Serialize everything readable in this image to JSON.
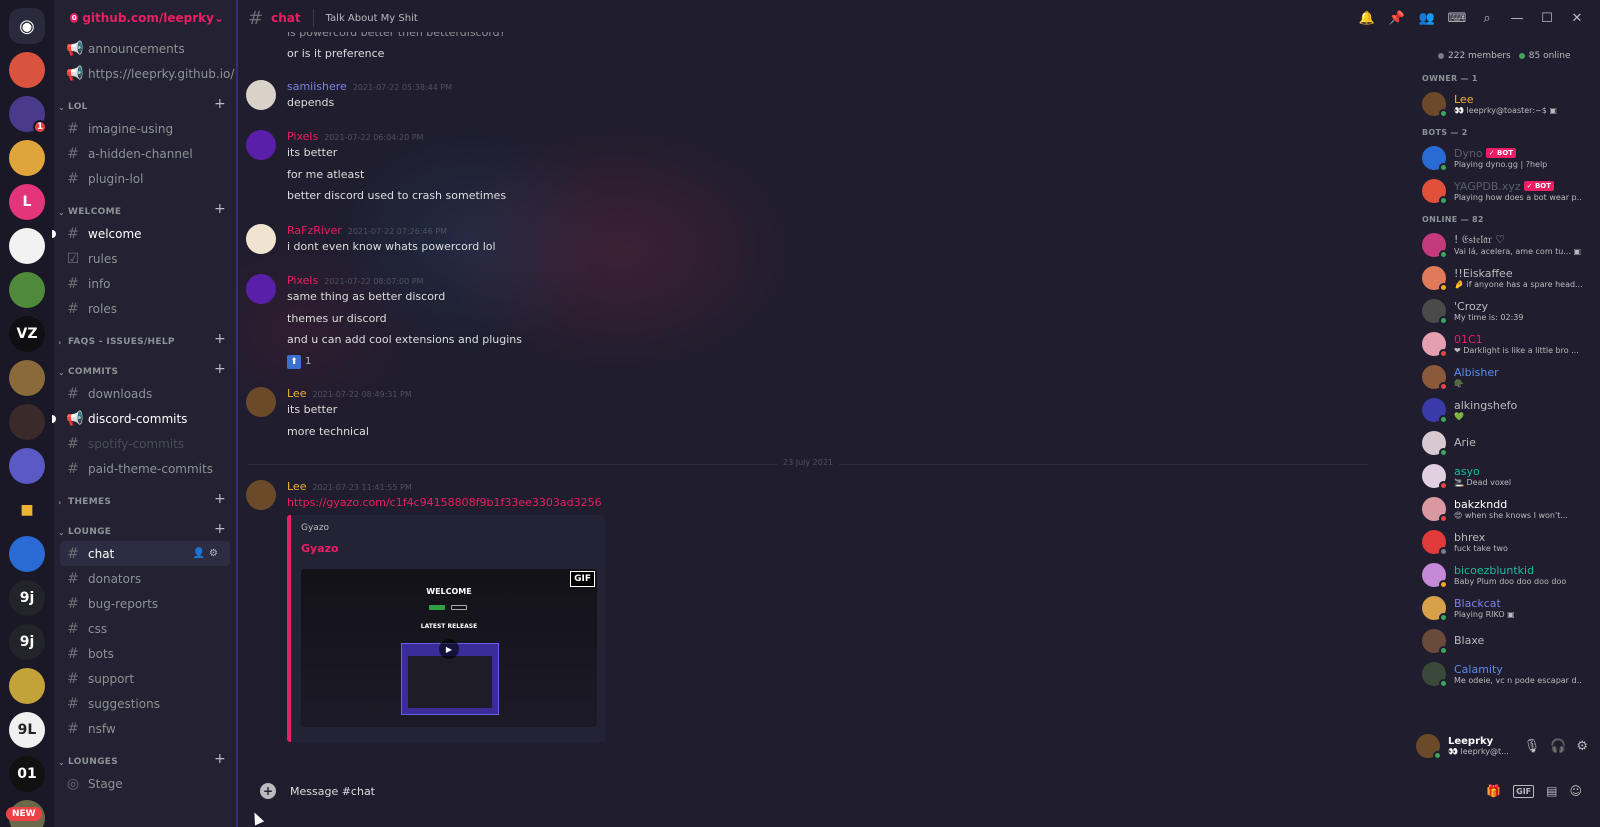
{
  "rail": {
    "servers": [
      {
        "name": "discord-home",
        "color": "#2b2a3c",
        "glyph": "◉"
      },
      {
        "name": "sunset",
        "color": "#d9533f"
      },
      {
        "name": "city",
        "color": "#4a3a8c",
        "badge": "1"
      },
      {
        "name": "pinwheel",
        "color": "#e0a43c"
      },
      {
        "name": "pink-l",
        "color": "#e5357a",
        "glyph": "L"
      },
      {
        "name": "goose",
        "color": "#f2f2f2"
      },
      {
        "name": "frog",
        "color": "#4e8a3a"
      },
      {
        "name": "vz",
        "color": "#0f0f12",
        "glyph": "VZ"
      },
      {
        "name": "portrait",
        "color": "#8a6a3a"
      },
      {
        "name": "dark-portrait",
        "color": "#3a2a2a"
      },
      {
        "name": "grid",
        "color": "#5b5ac4"
      },
      {
        "name": "folder",
        "color": "#1a1826",
        "glyph": "■"
      },
      {
        "name": "brush",
        "color": "#2a6ad4"
      },
      {
        "name": "9j",
        "color": "#23232a",
        "glyph": "9j"
      },
      {
        "name": "9j-2",
        "color": "#23232a",
        "glyph": "9j"
      },
      {
        "name": "penguin",
        "color": "#c4a23a"
      },
      {
        "name": "9l",
        "color": "#f0f0f0",
        "glyph": "9L"
      },
      {
        "name": "binary",
        "color": "#111111",
        "glyph": "01"
      },
      {
        "name": "mixed",
        "color": "#6a6a4a"
      }
    ],
    "new_label": "NEW"
  },
  "guild": {
    "name": "github.com/leeprky",
    "badge": "0"
  },
  "channels": {
    "top": [
      {
        "name": "announcements",
        "icon": "📢",
        "style": "normal"
      },
      {
        "name": "https://leeprky.github.io/",
        "icon": "📢",
        "style": "normal"
      }
    ],
    "categories": [
      {
        "label": "LOL",
        "open": true,
        "items": [
          {
            "name": "imagine-using",
            "icon": "#"
          },
          {
            "name": "a-hidden-channel",
            "icon": "#"
          },
          {
            "name": "plugin-lol",
            "icon": "#"
          }
        ]
      },
      {
        "label": "WELCOME",
        "open": true,
        "items": [
          {
            "name": "welcome",
            "icon": "#",
            "style": "bright",
            "unread": true
          },
          {
            "name": "rules",
            "icon": "☑"
          },
          {
            "name": "info",
            "icon": "#"
          },
          {
            "name": "roles",
            "icon": "#"
          }
        ]
      },
      {
        "label": "FAQS - ISSUES/HELP",
        "open": false,
        "items": []
      },
      {
        "label": "COMMITS",
        "open": true,
        "items": [
          {
            "name": "downloads",
            "icon": "#"
          },
          {
            "name": "discord-commits",
            "icon": "📢",
            "style": "bright",
            "unread": true
          },
          {
            "name": "spotify-commits",
            "icon": "#",
            "style": "muted"
          },
          {
            "name": "paid-theme-commits",
            "icon": "#"
          }
        ]
      },
      {
        "label": "THEMES",
        "open": false,
        "items": []
      },
      {
        "label": "LOUNGE",
        "open": true,
        "items": [
          {
            "name": "chat",
            "icon": "#",
            "style": "active"
          },
          {
            "name": "donators",
            "icon": "#"
          },
          {
            "name": "bug-reports",
            "icon": "#"
          },
          {
            "name": "css",
            "icon": "#"
          },
          {
            "name": "bots",
            "icon": "#"
          },
          {
            "name": "support",
            "icon": "#"
          },
          {
            "name": "suggestions",
            "icon": "#"
          },
          {
            "name": "nsfw",
            "icon": "#"
          }
        ]
      },
      {
        "label": "LOUNGES",
        "open": true,
        "items": [
          {
            "name": "Stage",
            "icon": "◎"
          }
        ]
      }
    ]
  },
  "header": {
    "channel": "chat",
    "topic": "Talk About My Shit"
  },
  "messages": {
    "partial_top": "is powercord better then betterdiscord?",
    "groups": [
      {
        "lines": [
          "or is it preference"
        ],
        "continuation": true
      },
      {
        "author": "samiishere",
        "color": "#7c83e8",
        "ts": "2021-07-22 05:38:44 PM",
        "avatar": "#d8d2c8",
        "lines": [
          "depends"
        ]
      },
      {
        "author": "Pixels",
        "color": "#e91e63",
        "ts": "2021-07-22 06:04:20 PM",
        "avatar": "#5a1fa8",
        "lines": [
          "its better",
          "for me atleast",
          "better discord used to crash sometimes"
        ]
      },
      {
        "author": "RaFzRiver",
        "color": "#e91e63",
        "ts": "2021-07-22 07:26:46 PM",
        "avatar": "#f0e4d0",
        "lines": [
          "i dont even know whats powercord lol"
        ]
      },
      {
        "author": "Pixels",
        "color": "#e91e63",
        "ts": "2021-07-22 08:07:00 PM",
        "avatar": "#5a1fa8",
        "lines": [
          "same thing as better discord",
          "themes ur discord",
          "and u can add cool extensions and plugins"
        ],
        "reaction": {
          "emoji": "⬆",
          "count": "1"
        }
      },
      {
        "author": "Lee",
        "color": "#f0b232",
        "ts": "2021-07-22 08:49:31 PM",
        "avatar": "#6b4a2a",
        "lines": [
          "its better",
          "more technical"
        ]
      }
    ],
    "date_divider": "23 July 2021",
    "last": {
      "author": "Lee",
      "color": "#f0b232",
      "ts": "2021-07-23 11:41:55 PM",
      "avatar": "#6b4a2a",
      "link": "https://gyazo.com/c1f4c94158808f9b1f33ee3303ad3256",
      "embed": {
        "provider": "Gyazo",
        "title": "Gyazo",
        "gif": "GIF",
        "welcome": "WELCOME",
        "latest": "LATEST RELEASE"
      }
    }
  },
  "composer": {
    "placeholder": "Message #chat"
  },
  "members": {
    "total": "222 members",
    "online": "85 online",
    "groups": [
      {
        "label": "OWNER — 1",
        "items": [
          {
            "name": "Lee",
            "color": "#f0b232",
            "sub": "👀 leeprky@toaster:~$ ▣",
            "avatar": "#6b4a2a",
            "status": "#3ba55d"
          }
        ]
      },
      {
        "label": "BOTS — 2",
        "items": [
          {
            "name": "Dyno",
            "color": "#5c5f6a",
            "bot": "✓ BOT",
            "sub": "Playing dyno.gg | ?help",
            "avatar": "#2a6ad4",
            "status": "#3ba55d"
          },
          {
            "name": "YAGPDB.xyz",
            "color": "#5c5f6a",
            "bot": "✓ BOT",
            "sub": "Playing how does a bot wear p...",
            "avatar": "#e0503a",
            "status": "#3ba55d"
          }
        ]
      },
      {
        "label": "ONLINE — 82",
        "items": [
          {
            "name": "! 𝔈𝔰𝔱𝔢𝔩𝔞𝔯 ♡",
            "color": "#b9bbbe",
            "sub": "Vai lá, acelera, ame com tu... ▣",
            "avatar": "#c43a7a",
            "status": "#3ba55d"
          },
          {
            "name": "!!Eiskaffee",
            "color": "#b9bbbe",
            "sub": "🤌 if anyone has a spare head...",
            "avatar": "#e07a5a",
            "status": "#faa61a"
          },
          {
            "name": "'Crozy",
            "color": "#b9bbbe",
            "sub": "My time is: 02:39",
            "avatar": "#4a4a4a",
            "status": "#3ba55d"
          },
          {
            "name": "01C1",
            "color": "#e91e63",
            "sub": "❤ Darklight is like a little bro ...",
            "avatar": "#e5a0b0",
            "status": "#ed4245"
          },
          {
            "name": "Albisher",
            "color": "#5b8def",
            "sub": "🪖",
            "avatar": "#8a5a3a",
            "status": "#ed4245"
          },
          {
            "name": "alkingshefo",
            "color": "#b9bbbe",
            "sub": "💚",
            "avatar": "#3a3aa8",
            "status": "#3ba55d"
          },
          {
            "name": "Arie",
            "color": "#b9bbbe",
            "sub": "",
            "avatar": "#d8c8d0",
            "status": "#3ba55d"
          },
          {
            "name": "asyo",
            "color": "#1abc9c",
            "sub": "🚬 Dead voxel",
            "avatar": "#e0d0e0",
            "status": "#ed4245"
          },
          {
            "name": "bakzkndd",
            "color": "#ffffff",
            "sub": "😍 when she knows I won't...",
            "avatar": "#d89aa0",
            "status": "#ed4245"
          },
          {
            "name": "bhrex",
            "color": "#b9bbbe",
            "sub": "fuck take two",
            "avatar": "#e03a3a",
            "status": "#747f8d"
          },
          {
            "name": "bicoezbluntkid",
            "color": "#1abc9c",
            "sub": "Baby Plum doo doo doo doo",
            "avatar": "#c48ad8",
            "status": "#faa61a"
          },
          {
            "name": "Blackcat",
            "color": "#7c83e8",
            "sub": "Playing RIKO ▣",
            "avatar": "#d8a04a",
            "status": "#3ba55d"
          },
          {
            "name": "Blaxe",
            "color": "#b9bbbe",
            "sub": "",
            "avatar": "#6a4a3a",
            "status": "#3ba55d"
          },
          {
            "name": "Calamity",
            "color": "#5b8def",
            "sub": "Me odeie, vc n pode escapar d...",
            "avatar": "#3a4a3a",
            "status": "#3ba55d"
          }
        ]
      }
    ]
  },
  "user": {
    "name": "Leeprky",
    "sub": "👀 leeprky@t..."
  }
}
